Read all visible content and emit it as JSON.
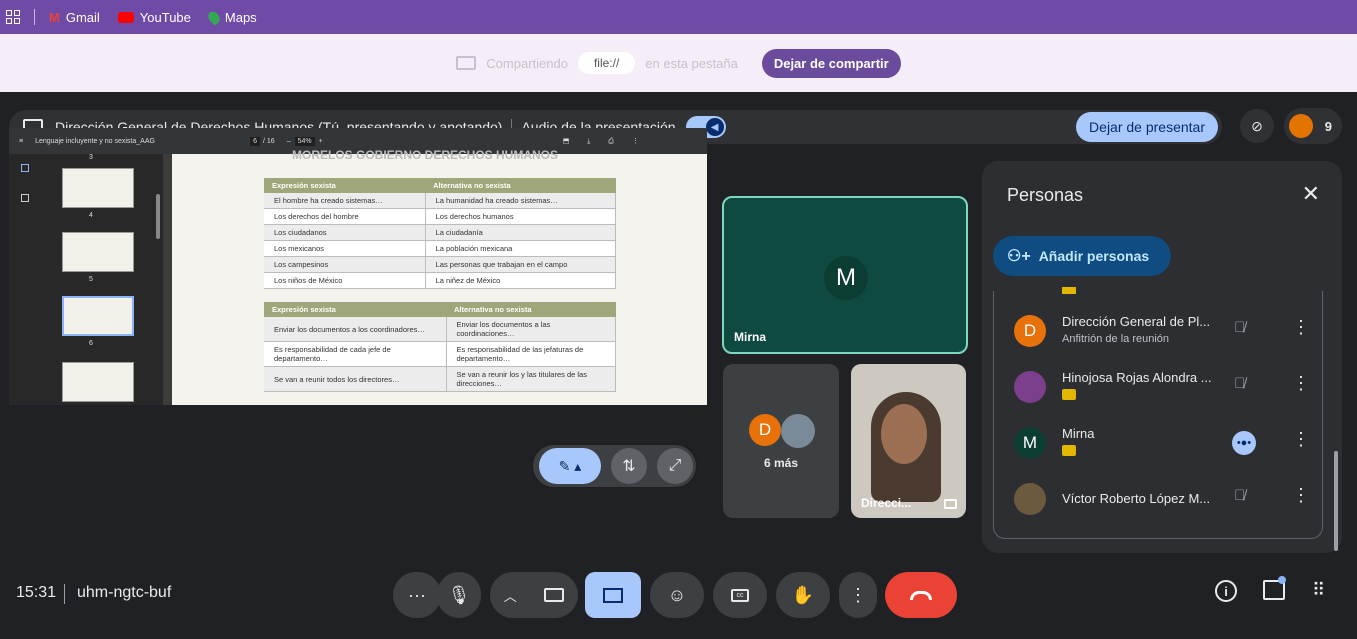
{
  "bookmarks": {
    "gmail": "Gmail",
    "youtube": "YouTube",
    "maps": "Maps"
  },
  "share_bar": {
    "prefix": "Compartiendo",
    "source": "file://",
    "suffix": "en esta pestaña",
    "stop_label": "Dejar de compartir"
  },
  "present_bar": {
    "title": "Dirección General de Derechos Humanos (Tú, presentando y anotando)",
    "audio_label": "Audio de la presentación",
    "stop_label": "Dejar de presentar",
    "participant_count": "9"
  },
  "document": {
    "title": "Lenguaje incluyente y no sexista_AAG",
    "page_current": "6",
    "page_total": "/ 16",
    "zoom": "54%",
    "thumb_numbers": [
      "3",
      "4",
      "5",
      "6"
    ],
    "header_text": "MORELOS  GOBIERNO  DERECHOS HUMANOS",
    "table1": {
      "headers": [
        "Expresión sexista",
        "Alternativa no sexista"
      ],
      "rows": [
        [
          "El hombre ha creado sistemas…",
          "La humanidad ha creado sistemas…"
        ],
        [
          "Los derechos del hombre",
          "Los derechos humanos"
        ],
        [
          "Los ciudadanos",
          "La ciudadanía"
        ],
        [
          "Los mexicanos",
          "La población mexicana"
        ],
        [
          "Los campesinos",
          "Las personas que trabajan en el campo"
        ],
        [
          "Los niños de México",
          "La niñez de México"
        ]
      ]
    },
    "table2": {
      "headers": [
        "Expresión sexista",
        "Alternativa no sexista"
      ],
      "rows": [
        [
          "Enviar los documentos a los coordinadores…",
          "Enviar los documentos a las coordinaciones…"
        ],
        [
          "Es responsabilidad de cada jefe de departamento…",
          "Es responsabilidad de las jefaturas de departamento…"
        ],
        [
          "Se van a reunir todos los directores…",
          "Se van a reunir los y las titulares de las direcciones…"
        ]
      ]
    }
  },
  "tiles": {
    "main": {
      "initial": "M",
      "name": "Mirna"
    },
    "more": {
      "initial": "D",
      "label": "6 más"
    },
    "video": {
      "name": "Direcci..."
    }
  },
  "people_panel": {
    "title": "Personas",
    "add_label": "Añadir personas",
    "people": [
      {
        "initial": "D",
        "name": "Dirección General de Pl...",
        "role": "Anfitrión de la reunión",
        "avatar_color": "#e8710a"
      },
      {
        "initial": "",
        "name": "Hinojosa Rojas Alondra ...",
        "role": "",
        "avatar_color": "#7b3f8c"
      },
      {
        "initial": "M",
        "name": "Mirna",
        "role": "",
        "avatar_color": "#0c3d33"
      },
      {
        "initial": "",
        "name": "Víctor Roberto López M...",
        "role": "",
        "avatar_color": "#6b5a3e"
      }
    ]
  },
  "bottom_bar": {
    "time": "15:31",
    "meeting_code": "uhm-ngtc-buf"
  },
  "colors": {
    "accent": "#a8c7fa",
    "hangup": "#ea4335",
    "bookmarks_bg": "#6f4aa6"
  }
}
